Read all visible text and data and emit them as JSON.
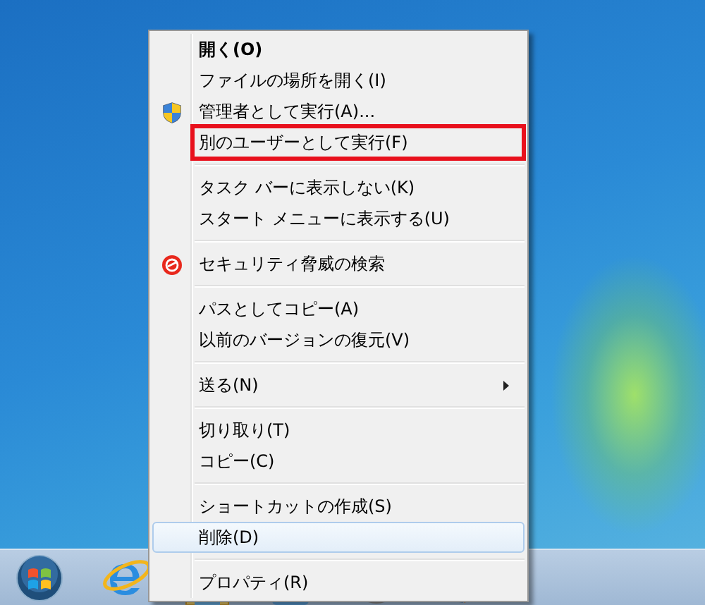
{
  "context_menu": {
    "items": [
      {
        "kind": "item",
        "label": "開く(O)",
        "default": true,
        "selected": false,
        "annotated": false
      },
      {
        "kind": "item",
        "label": "ファイルの場所を開く(I)",
        "default": false,
        "selected": false,
        "annotated": false
      },
      {
        "kind": "admin",
        "label": "管理者として実行(A)...",
        "default": false,
        "selected": false,
        "annotated": false
      },
      {
        "kind": "item",
        "label": "別のユーザーとして実行(F)",
        "default": false,
        "selected": false,
        "annotated": true
      },
      {
        "kind": "separator"
      },
      {
        "kind": "item",
        "label": "タスク バーに表示しない(K)",
        "default": false,
        "selected": false,
        "annotated": false
      },
      {
        "kind": "item",
        "label": "スタート メニューに表示する(U)",
        "default": false,
        "selected": false,
        "annotated": false
      },
      {
        "kind": "separator"
      },
      {
        "kind": "scan",
        "label": "セキュリティ脅威の検索",
        "default": false,
        "selected": false,
        "annotated": false
      },
      {
        "kind": "separator"
      },
      {
        "kind": "item",
        "label": "パスとしてコピー(A)",
        "default": false,
        "selected": false,
        "annotated": false
      },
      {
        "kind": "item",
        "label": "以前のバージョンの復元(V)",
        "default": false,
        "selected": false,
        "annotated": false
      },
      {
        "kind": "separator"
      },
      {
        "kind": "item",
        "label": "送る(N)",
        "submenu": true,
        "default": false,
        "selected": false,
        "annotated": false
      },
      {
        "kind": "separator"
      },
      {
        "kind": "item",
        "label": "切り取り(T)",
        "default": false,
        "selected": false,
        "annotated": false
      },
      {
        "kind": "item",
        "label": "コピー(C)",
        "default": false,
        "selected": false,
        "annotated": false
      },
      {
        "kind": "separator"
      },
      {
        "kind": "item",
        "label": "ショートカットの作成(S)",
        "default": false,
        "selected": false,
        "annotated": false
      },
      {
        "kind": "item",
        "label": "削除(D)",
        "default": false,
        "selected": true,
        "annotated": false
      },
      {
        "kind": "separator"
      },
      {
        "kind": "item",
        "label": "プロパティ(R)",
        "default": false,
        "selected": false,
        "annotated": false
      }
    ]
  }
}
